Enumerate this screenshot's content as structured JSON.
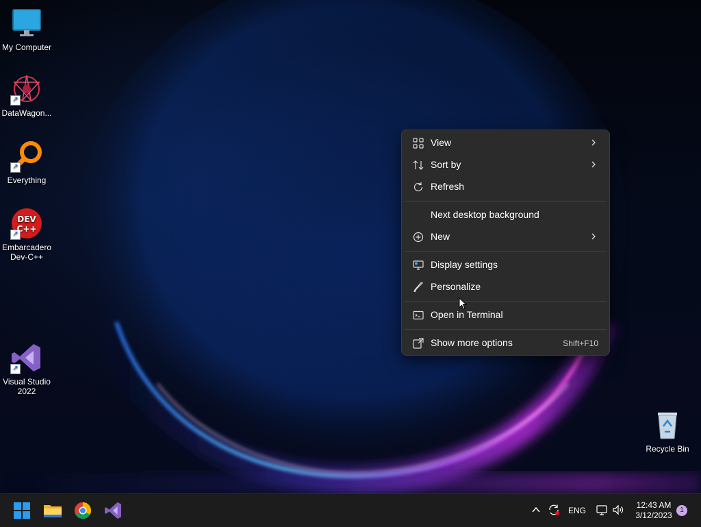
{
  "desktop": {
    "icons": [
      {
        "label": "My Computer"
      },
      {
        "label": "DataWagon..."
      },
      {
        "label": "Everything"
      },
      {
        "label": "Embarcadero Dev-C++"
      },
      {
        "label": "Visual Studio 2022"
      },
      {
        "label": "Recycle Bin"
      }
    ],
    "devcpp_logo_text": [
      "DEV",
      "C++"
    ]
  },
  "context_menu": {
    "items": [
      {
        "label": "View",
        "icon": "grid-icon",
        "submenu": true
      },
      {
        "label": "Sort by",
        "icon": "sort-icon",
        "submenu": true
      },
      {
        "label": "Refresh",
        "icon": "refresh-icon",
        "submenu": false
      },
      {
        "label": "Next desktop background",
        "icon": "",
        "submenu": false
      },
      {
        "label": "New",
        "icon": "plus-circle-icon",
        "submenu": true
      },
      {
        "label": "Display settings",
        "icon": "monitor-settings-icon",
        "submenu": false
      },
      {
        "label": "Personalize",
        "icon": "brush-icon",
        "submenu": false
      },
      {
        "label": "Open in Terminal",
        "icon": "terminal-icon",
        "submenu": false
      },
      {
        "label": "Show more options",
        "icon": "more-options-icon",
        "submenu": false,
        "shortcut": "Shift+F10"
      }
    ]
  },
  "taskbar": {
    "pinned": [
      {
        "name": "start-button",
        "icon": "windows-logo-icon"
      },
      {
        "name": "file-explorer-button",
        "icon": "folder-icon"
      },
      {
        "name": "chrome-button",
        "icon": "chrome-icon"
      },
      {
        "name": "visual-studio-button",
        "icon": "visual-studio-icon"
      }
    ],
    "tray": {
      "language": "ENG",
      "time": "12:43 AM",
      "date": "3/12/2023",
      "notification_count": "1"
    }
  },
  "colors": {
    "menu_bg": "#2b2b2b",
    "taskbar_bg": "#1c1c1c",
    "accent_blue": "#0078d4",
    "visual_studio_purple": "#8661c5"
  }
}
